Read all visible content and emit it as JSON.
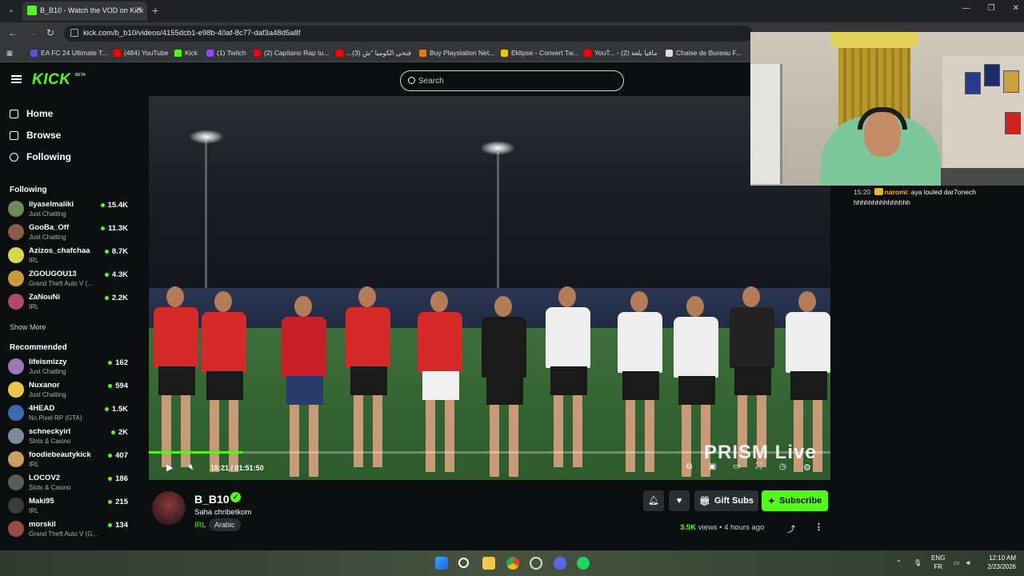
{
  "browser": {
    "tab_title": "B_B10 - Watch the VOD on Kick",
    "url": "kick.com/b_b10/videos/4155dcb1-e98b-40af-8c77-daf3a48d5a8f",
    "bookmarks": [
      {
        "label": "EA FC 24 Ultimate T...",
        "icon": "ea-icon",
        "color": "#6a4bd8"
      },
      {
        "label": "(484) YouTube",
        "icon": "youtube-icon",
        "color": "#ff0000"
      },
      {
        "label": "Kick",
        "icon": "kick-icon",
        "color": "#53fc18"
      },
      {
        "label": "(1) Twitch",
        "icon": "twitch-icon",
        "color": "#9146ff"
      },
      {
        "label": "(2) Capitano Rap tu...",
        "icon": "youtube-icon",
        "color": "#ff0000"
      },
      {
        "label": "...فتحي الكوميا \"ش (3)",
        "icon": "youtube-icon",
        "color": "#ff0000"
      },
      {
        "label": "Buy Playstation Net...",
        "icon": "store-icon",
        "color": "#e07a1e"
      },
      {
        "label": "Eklipse - Convert Tw...",
        "icon": "eklipse-icon",
        "color": "#f2c417"
      },
      {
        "label": "YouT... - مافيا بلعة (2)",
        "icon": "youtube-icon",
        "color": "#ff0000"
      },
      {
        "label": "Chaise de Bureau F...",
        "icon": "page-icon",
        "color": "#dddddd"
      }
    ]
  },
  "header": {
    "logo": "KICK",
    "logo_sub": "BETA",
    "search_placeholder": "Search"
  },
  "sidebar": {
    "nav": [
      {
        "label": "Home",
        "icon": "home-icon"
      },
      {
        "label": "Browse",
        "icon": "browse-icon"
      },
      {
        "label": "Following",
        "icon": "heart-icon"
      }
    ],
    "following_title": "Following",
    "following": [
      {
        "name": "ilyaselmaliki",
        "category": "Just Chatting",
        "viewers": "15.4K",
        "color": "#6d8a5a"
      },
      {
        "name": "GooBa_Off",
        "category": "Just Chatting",
        "viewers": "11.3K",
        "color": "#8a5a4a"
      },
      {
        "name": "Azizos_chafchaa",
        "category": "IRL",
        "viewers": "8.7K",
        "color": "#d8d84a"
      },
      {
        "name": "ZGOUGOU13",
        "category": "Grand Theft Auto V (...",
        "viewers": "4.3K",
        "color": "#c89a3a"
      },
      {
        "name": "ZaNouNi",
        "category": "IRL",
        "viewers": "2.2K",
        "color": "#b04a6a"
      }
    ],
    "show_more": "Show More",
    "recommended_title": "Recommended",
    "recommended": [
      {
        "name": "lifeismizzy",
        "category": "Just Chatting",
        "viewers": "162",
        "color": "#9a7ab0"
      },
      {
        "name": "Nuxanor",
        "category": "Just Chatting",
        "viewers": "594",
        "color": "#e8c84a"
      },
      {
        "name": "4HEAD",
        "category": "No Pixel RP (GTA)",
        "viewers": "1.5K",
        "color": "#3a6ab0"
      },
      {
        "name": "schneckyirl",
        "category": "Slots & Casino",
        "viewers": "2K",
        "color": "#7a8a9a"
      },
      {
        "name": "foodiebeautykick",
        "category": "IRL",
        "viewers": "407",
        "color": "#c8a060"
      },
      {
        "name": "LOCOV2",
        "category": "Slots & Casino",
        "viewers": "186",
        "color": "#5a5a5a"
      },
      {
        "name": "Maki95",
        "category": "IRL",
        "viewers": "215",
        "color": "#3a3a3a"
      },
      {
        "name": "morskil",
        "category": "Grand Theft Auto V (G...",
        "viewers": "134",
        "color": "#9a4a4a"
      }
    ]
  },
  "video": {
    "current_time": "15:21",
    "duration": "01:51:50",
    "progress_percent": 13.7,
    "watermark": "PRISM Live"
  },
  "chat": {
    "time": "15:20",
    "user": "naromi",
    "message": "aya louled dar7onech hhhhhhhhhhhhhhh"
  },
  "channel": {
    "name": "B_B10",
    "stream_title": "Saha chribetkom",
    "category": "IRL",
    "tag": "Arabic",
    "gift_label": "Gift Subs",
    "subscribe_label": "Subscribe",
    "views": "3.5K",
    "views_word": "views",
    "age": "4 hours ago"
  },
  "taskbar": {
    "lang_top": "ENG",
    "lang_bottom": "FR",
    "clock_time": "12:10 AM",
    "clock_date": "2/23/2026"
  },
  "colors": {
    "accent": "#53fc18",
    "background": "#0b0e0f",
    "chat_user": "#f2b417"
  }
}
